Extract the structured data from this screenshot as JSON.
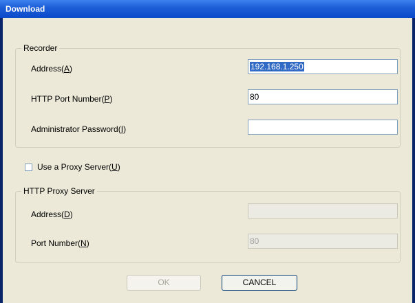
{
  "window": {
    "title": "Download"
  },
  "recorder": {
    "group_title": "Recorder",
    "address": {
      "label": "Address(",
      "mnemonic": "A",
      "suffix": ")",
      "value": "192.168.1.250"
    },
    "http_port": {
      "label": "HTTP Port Number(",
      "mnemonic": "P",
      "suffix": ")",
      "value": "80"
    },
    "admin_password": {
      "label": "Administrator Password(",
      "mnemonic": "I",
      "suffix": ")",
      "value": ""
    }
  },
  "proxy_checkbox": {
    "label": "Use a Proxy Server(",
    "mnemonic": "U",
    "suffix": ")",
    "checked": false
  },
  "proxy": {
    "group_title": "HTTP Proxy Server",
    "address": {
      "label": "Address(",
      "mnemonic": "D",
      "suffix": ")",
      "value": ""
    },
    "port": {
      "label": "Port Number(",
      "mnemonic": "N",
      "suffix": ")",
      "value": "80"
    }
  },
  "buttons": {
    "ok": "OK",
    "cancel": "CANCEL"
  }
}
